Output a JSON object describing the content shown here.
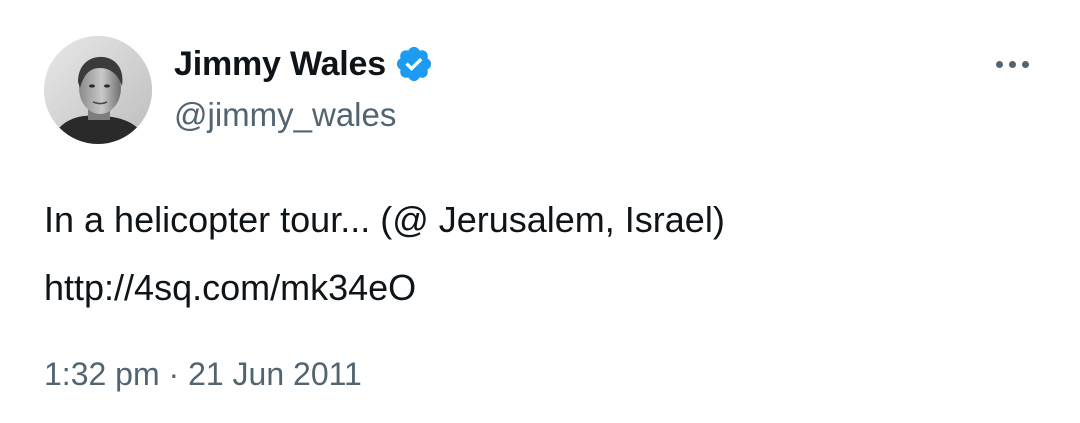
{
  "tweet": {
    "author": {
      "display_name": "Jimmy Wales",
      "handle": "@jimmy_wales",
      "verified": true,
      "avatar_icon": "profile-photo"
    },
    "more_icon": "more-horizontal-icon",
    "text_line1": "In a helicopter tour... (@ Jerusalem, Israel)",
    "link": "http://4sq.com/mk34eO",
    "time": "1:32 pm",
    "separator": "·",
    "date": "21 Jun 2011"
  },
  "colors": {
    "primary_text": "#0f1419",
    "secondary_text": "#536471",
    "verified_blue": "#1d9bf0",
    "background": "#ffffff"
  }
}
